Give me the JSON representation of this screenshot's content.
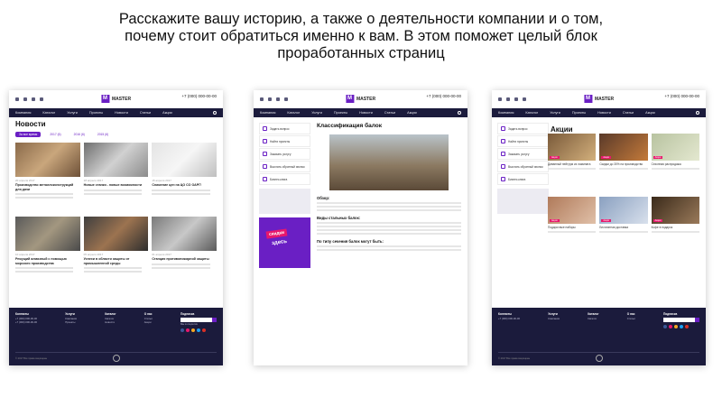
{
  "headline": {
    "line1": "Расскажите вашу историю, а также о деятельности компании и о том,",
    "line2": "почему стоит обратиться именно к вам. В этом поможет целый блок",
    "line3": "проработанных страниц"
  },
  "brand": {
    "logo_text": "MASTER",
    "phone": "+7 (000) 000-00-00",
    "accent": "#6a1fc4",
    "nav_bg": "#1b1b3c"
  },
  "nav": [
    "Компания",
    "Каталог",
    "Услуги",
    "Проекты",
    "Новости",
    "Статьи",
    "Акции"
  ],
  "news_page": {
    "title": "Новости",
    "filters": [
      "За все время",
      "2017 (6)",
      "2016 (6)",
      "2015 (6)"
    ],
    "cards": [
      {
        "date": "20 апреля 2017",
        "title": "Производство металлоконструкций для дачи"
      },
      {
        "date": "18 апреля 2017",
        "title": "Новые станки - новые возможности"
      },
      {
        "date": "15 апреля 2017",
        "title": "Снижение цен на ЦО СО ОАРГ!"
      },
      {
        "date": "10 апреля 2017",
        "title": "Режущий алмазный с помощью морского производства"
      },
      {
        "date": "05 апреля 2017",
        "title": "Успехи в области защиты от промышленной среды"
      },
      {
        "date": "01 апреля 2017",
        "title": "Станция противопожарной защиты"
      }
    ]
  },
  "article_page": {
    "title": "Классификация балок",
    "sidebar": [
      "Задать вопрос",
      "Найти проекты",
      "Заказать услугу",
      "Выслать обратный звонок",
      "Бизнес-книга"
    ],
    "banner_top": "скидки",
    "banner_bottom": "здесь",
    "section1": "Обзор:",
    "section2": "Виды стальных балок:",
    "section3": "По типу сечения балок могут быть:"
  },
  "promo_page": {
    "title": "Акции",
    "cards": [
      {
        "tag": "Акция",
        "title": "Диванный нейтрум из ламината"
      },
      {
        "tag": "Акция",
        "title": "Скидки до 30% на производство"
      },
      {
        "tag": "Акция",
        "title": "Сезонная распродажа"
      },
      {
        "tag": "Акция",
        "title": "Подарочные наборы"
      },
      {
        "tag": "Акция",
        "title": "Бесплатная доставка"
      },
      {
        "tag": "Акция",
        "title": "Кофе в подарок"
      }
    ]
  },
  "footer": {
    "col1": "Контакты",
    "col2": "Услуги",
    "col3": "Каталог",
    "col4": "О нас",
    "col5": "Подписка",
    "social_title": "Мы в соцсетях",
    "copyright": "© 2017 Все права защищены"
  }
}
